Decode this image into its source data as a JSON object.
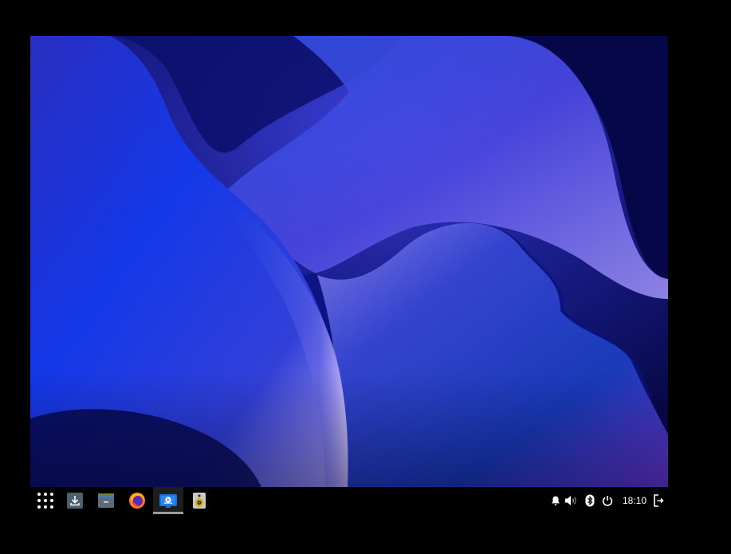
{
  "desktop": {
    "wallpaper_name": "abstract-blue-waves"
  },
  "taskbar": {
    "launcher_icon": "app-grid-icon",
    "apps": [
      {
        "name": "downloader",
        "icon": "download-icon",
        "active": false
      },
      {
        "name": "archive-manager",
        "icon": "archive-icon",
        "active": false
      },
      {
        "name": "firefox",
        "icon": "firefox-icon",
        "active": false
      },
      {
        "name": "screen-recorder",
        "icon": "screen-recorder-icon",
        "active": true
      },
      {
        "name": "speaker",
        "icon": "speaker-app-icon",
        "active": false
      }
    ],
    "tray": {
      "notification_icon": "bell-icon",
      "volume_icon": "volume-icon",
      "bluetooth_icon": "bluetooth-icon",
      "power_icon": "power-icon",
      "clock": "18:10",
      "logout_icon": "logout-icon"
    }
  },
  "colors": {
    "taskbar_bg": "#000000",
    "active_indicator": "#9a9a9a",
    "wallpaper_base": "#0a0a55"
  }
}
